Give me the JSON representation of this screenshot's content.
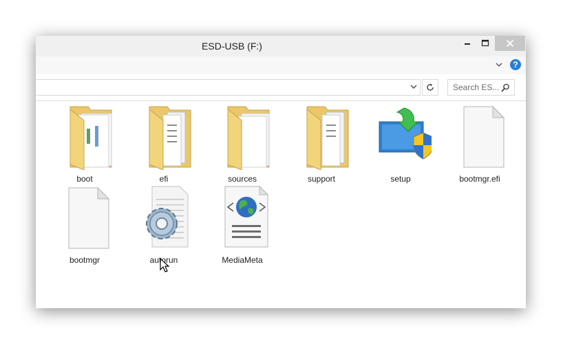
{
  "window": {
    "title": "ESD-USB (F:)"
  },
  "search": {
    "placeholder": "Search ES..."
  },
  "files": [
    {
      "name": "boot",
      "icon": "folder-icon"
    },
    {
      "name": "efi",
      "icon": "folder-icon"
    },
    {
      "name": "sources",
      "icon": "folder-icon"
    },
    {
      "name": "support",
      "icon": "folder-icon"
    },
    {
      "name": "setup",
      "icon": "setup-shield-icon"
    },
    {
      "name": "bootmgr.efi",
      "icon": "blank-file-icon"
    },
    {
      "name": "bootmgr",
      "icon": "blank-file-icon"
    },
    {
      "name": "autorun",
      "icon": "settings-gear-file-icon"
    },
    {
      "name": "MediaMeta",
      "icon": "xml-globe-file-icon"
    }
  ],
  "colors": {
    "folder_yellow": "#f2d57a",
    "help_blue": "#2a7fd4",
    "close_button": "#c7c7c7"
  }
}
